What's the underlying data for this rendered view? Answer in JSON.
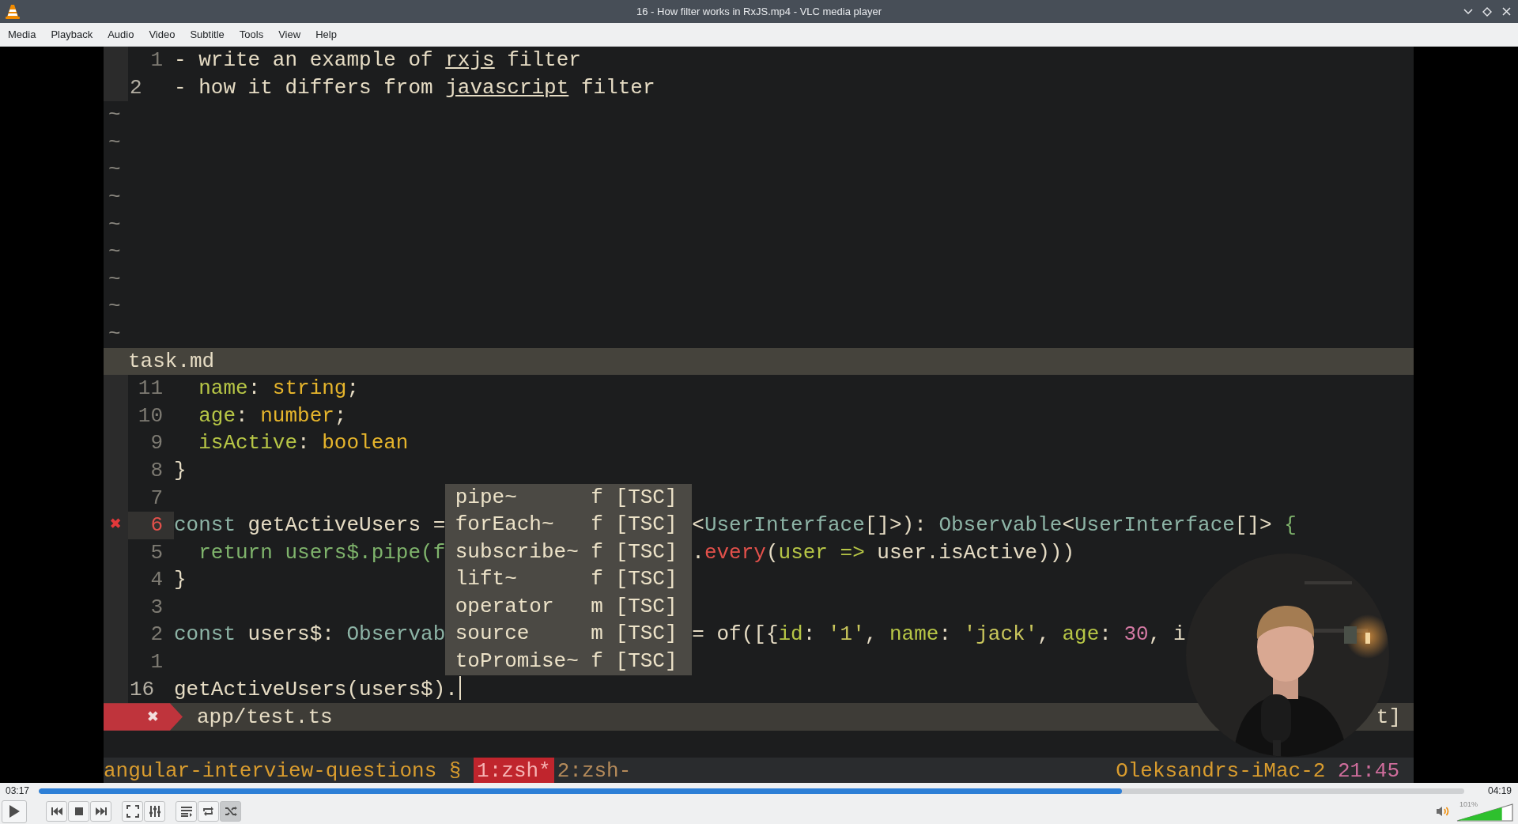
{
  "window": {
    "title": "16 - How filter works in RxJS.mp4 - VLC media player"
  },
  "menu": [
    "Media",
    "Playback",
    "Audio",
    "Video",
    "Subtitle",
    "Tools",
    "View",
    "Help"
  ],
  "video": {
    "top_pane": {
      "file": "task.md",
      "lines": [
        {
          "number": "1",
          "current": false,
          "segments": [
            {
              "text": "- write an example of ",
              "kind": "plain"
            },
            {
              "text": "rxjs",
              "kind": "link"
            },
            {
              "text": " filter",
              "kind": "plain"
            }
          ]
        },
        {
          "number": "2",
          "current": true,
          "segments": [
            {
              "text": "- how it differs from ",
              "kind": "plain"
            },
            {
              "text": "javascript",
              "kind": "link"
            },
            {
              "text": " filter",
              "kind": "plain"
            }
          ]
        }
      ],
      "empty_lines": [
        "~",
        "~",
        "~",
        "~",
        "~",
        "~",
        "~",
        "~",
        "~"
      ]
    },
    "bottom_pane": {
      "file": "app/test.ts",
      "file_error_sign": "✖",
      "right_text": "t]",
      "lines": [
        {
          "number": "11",
          "current": false,
          "indented": true,
          "segments": [
            {
              "text": "name",
              "kind": "prop"
            },
            {
              "text": ": ",
              "kind": "plain"
            },
            {
              "text": "string",
              "kind": "type"
            },
            {
              "text": ";",
              "kind": "plain"
            }
          ]
        },
        {
          "number": "10",
          "current": false,
          "indented": true,
          "segments": [
            {
              "text": "age",
              "kind": "prop"
            },
            {
              "text": ": ",
              "kind": "plain"
            },
            {
              "text": "number",
              "kind": "type"
            },
            {
              "text": ";",
              "kind": "plain"
            }
          ]
        },
        {
          "number": "9",
          "current": false,
          "indented": true,
          "segments": [
            {
              "text": "isActive",
              "kind": "prop"
            },
            {
              "text": ": ",
              "kind": "plain"
            },
            {
              "text": "boolean",
              "kind": "type"
            }
          ]
        },
        {
          "number": "8",
          "current": false,
          "segments": [
            {
              "text": "}",
              "kind": "plain"
            }
          ]
        },
        {
          "number": "7",
          "current": false
        },
        {
          "number": "6",
          "current": false,
          "error_sign": "✖",
          "left": [
            {
              "text": "const",
              "kind": "keyword"
            },
            {
              "text": " getActiveUsers =",
              "kind": "plain"
            }
          ],
          "right": [
            {
              "text": "<",
              "kind": "plain"
            },
            {
              "text": "UserInterface",
              "kind": "keyword"
            },
            {
              "text": "[]>): ",
              "kind": "plain"
            },
            {
              "text": "Observable",
              "kind": "keyword"
            },
            {
              "text": "<",
              "kind": "plain"
            },
            {
              "text": "UserInterface",
              "kind": "keyword"
            },
            {
              "text": "[]> ",
              "kind": "plain"
            },
            {
              "text": "{",
              "kind": "fn"
            }
          ]
        },
        {
          "number": "5",
          "current": false,
          "indented": true,
          "left": [
            {
              "text": "return users$.pipe(f",
              "kind": "fn"
            }
          ],
          "right": [
            {
              "text": ".",
              "kind": "plain"
            },
            {
              "text": "every",
              "kind": "error"
            },
            {
              "text": "(",
              "kind": "plain"
            },
            {
              "text": "user =>",
              "kind": "prop"
            },
            {
              "text": " user.isActive)))",
              "kind": "plain"
            }
          ]
        },
        {
          "number": "4",
          "current": false,
          "left": [
            {
              "text": "}",
              "kind": "plain"
            }
          ]
        },
        {
          "number": "3",
          "current": false
        },
        {
          "number": "2",
          "current": false,
          "left": [
            {
              "text": "const",
              "kind": "keyword"
            },
            {
              "text": " users$: ",
              "kind": "plain"
            },
            {
              "text": "Observab",
              "kind": "keyword"
            }
          ],
          "right": [
            {
              "text": "= of([{",
              "kind": "plain"
            },
            {
              "text": "id",
              "kind": "prop"
            },
            {
              "text": ": ",
              "kind": "plain"
            },
            {
              "text": "'1'",
              "kind": "string"
            },
            {
              "text": ", ",
              "kind": "plain"
            },
            {
              "text": "name",
              "kind": "prop"
            },
            {
              "text": ": ",
              "kind": "plain"
            },
            {
              "text": "'jack'",
              "kind": "string"
            },
            {
              "text": ", ",
              "kind": "plain"
            },
            {
              "text": "age",
              "kind": "prop"
            },
            {
              "text": ": ",
              "kind": "plain"
            },
            {
              "text": "30",
              "kind": "number"
            },
            {
              "text": ", i",
              "kind": "plain"
            }
          ]
        },
        {
          "number": "1",
          "current": false
        },
        {
          "number": "16",
          "current": true,
          "segments": [
            {
              "text": "getActiveUsers(users$).",
              "kind": "plain"
            }
          ]
        }
      ],
      "completion": [
        {
          "label": "pipe~",
          "type": "f",
          "source": "[TSC]"
        },
        {
          "label": "forEach~",
          "type": "f",
          "source": "[TSC]"
        },
        {
          "label": "subscribe~",
          "type": "f",
          "source": "[TSC]"
        },
        {
          "label": "lift~",
          "type": "f",
          "source": "[TSC]"
        },
        {
          "label": "operator",
          "type": "m",
          "source": "[TSC]"
        },
        {
          "label": "source",
          "type": "m",
          "source": "[TSC]"
        },
        {
          "label": "toPromise~",
          "type": "f",
          "source": "[TSC]"
        }
      ]
    },
    "tmux": {
      "session": "angular-interview-questions",
      "separator": "§",
      "windows": [
        {
          "label": "1:zsh*",
          "selected": true
        },
        {
          "label": "2:zsh-",
          "selected": false
        }
      ],
      "host": "Oleksandrs-iMac-2",
      "time": "21:45"
    }
  },
  "seek": {
    "elapsed": "03:17",
    "total": "04:19",
    "level": 0.76
  },
  "controls": [
    {
      "kind": "play",
      "on": false
    },
    {
      "kind": "previous",
      "on": false
    },
    {
      "kind": "stop",
      "on": false
    },
    {
      "kind": "next",
      "on": false
    },
    {
      "kind": "fullscreen",
      "on": false
    },
    {
      "kind": "extended",
      "on": false
    },
    {
      "kind": "playlist",
      "on": false
    },
    {
      "kind": "loop",
      "on": false
    },
    {
      "kind": "shuffle",
      "on": true
    }
  ],
  "volume": {
    "reading": "101%",
    "level": 0.81,
    "muted": false
  }
}
